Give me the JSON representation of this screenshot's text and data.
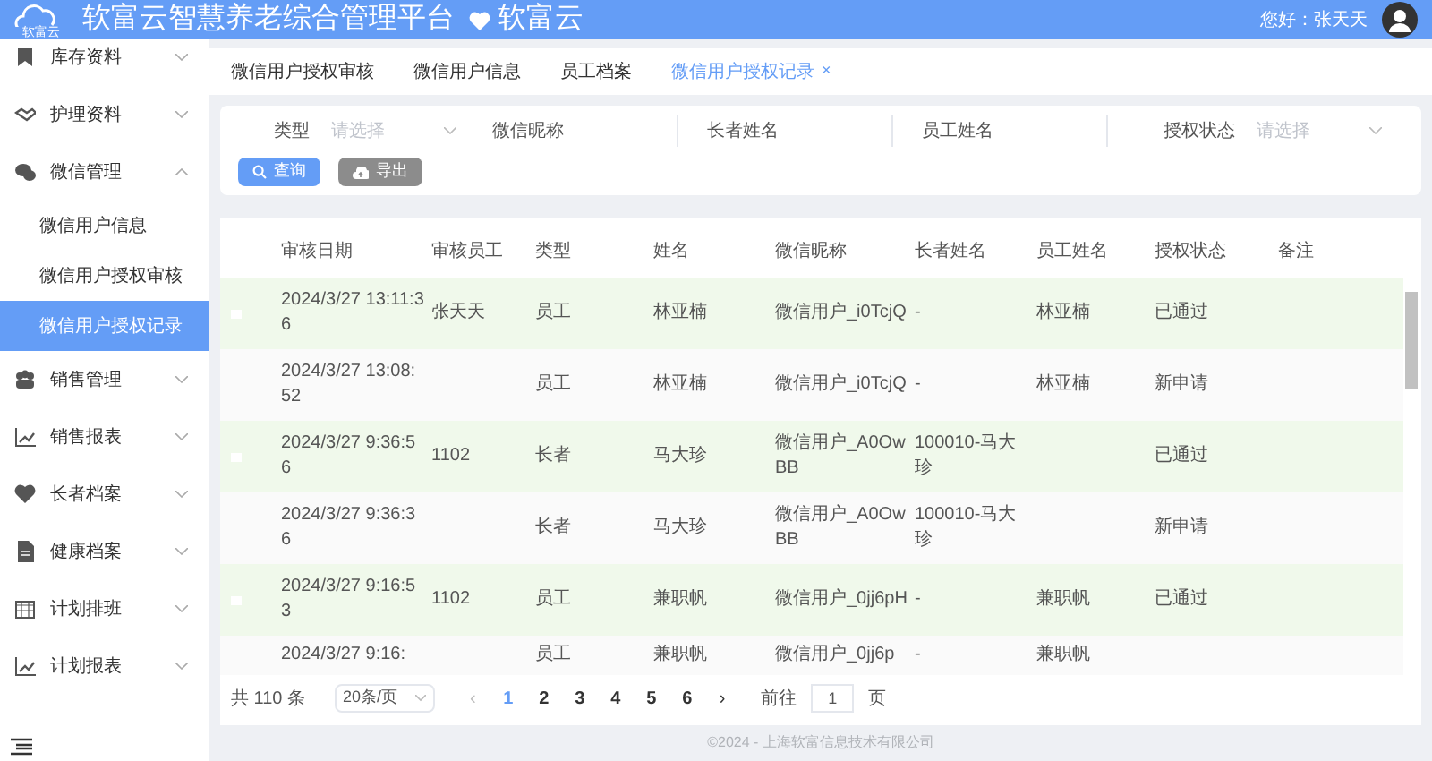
{
  "header": {
    "title": "软富云智慧养老综合管理平台",
    "brand": "软富云",
    "logo_text": "软富云",
    "greeting": "您好：张天天"
  },
  "sidebar": {
    "items": [
      {
        "label": "库存资料",
        "expanded": false
      },
      {
        "label": "护理资料",
        "expanded": false
      },
      {
        "label": "微信管理",
        "expanded": true,
        "children": [
          {
            "label": "微信用户信息",
            "selected": false
          },
          {
            "label": "微信用户授权审核",
            "selected": false
          },
          {
            "label": "微信用户授权记录",
            "selected": true
          }
        ]
      },
      {
        "label": "销售管理",
        "expanded": false
      },
      {
        "label": "销售报表",
        "expanded": false
      },
      {
        "label": "长者档案",
        "expanded": false
      },
      {
        "label": "健康档案",
        "expanded": false
      },
      {
        "label": "计划排班",
        "expanded": false
      },
      {
        "label": "计划报表",
        "expanded": false
      }
    ]
  },
  "tabs": [
    {
      "label": "微信用户授权审核",
      "selected": false
    },
    {
      "label": "微信用户信息",
      "selected": false
    },
    {
      "label": "员工档案",
      "selected": false
    },
    {
      "label": "微信用户授权记录",
      "selected": true,
      "close": "×"
    }
  ],
  "filters": [
    {
      "kind": "select",
      "label": "类型",
      "placeholder": "请选择"
    },
    {
      "kind": "input",
      "label": "微信昵称"
    },
    {
      "kind": "input",
      "label": "长者姓名"
    },
    {
      "kind": "input",
      "label": "员工姓名"
    },
    {
      "kind": "select",
      "label": "授权状态",
      "placeholder": "请选择"
    }
  ],
  "buttons": [
    {
      "kind": "search",
      "label": "查询"
    },
    {
      "kind": "export",
      "label": "导出"
    }
  ],
  "table": {
    "columns": [
      "审核日期",
      "审核员工",
      "类型",
      "姓名",
      "微信昵称",
      "长者姓名",
      "员工姓名",
      "授权状态",
      "备注"
    ],
    "rows": [
      [
        "2024/3/27 13:11:36",
        "张天天",
        "员工",
        "林亚楠",
        "微信用户_i0TcjQ",
        "-",
        "林亚楠",
        "已通过",
        ""
      ],
      [
        "2024/3/27 13:08:52",
        "",
        "员工",
        "林亚楠",
        "微信用户_i0TcjQ",
        "-",
        "林亚楠",
        "新申请",
        ""
      ],
      [
        "2024/3/27 9:36:56",
        "1102",
        "长者",
        "马大珍",
        "微信用户_A0OwBB",
        "100010-马大珍",
        "",
        "已通过",
        ""
      ],
      [
        "2024/3/27 9:36:36",
        "",
        "长者",
        "马大珍",
        "微信用户_A0OwBB",
        "100010-马大珍",
        "",
        "新申请",
        ""
      ],
      [
        "2024/3/27 9:16:53",
        "1102",
        "员工",
        "兼职帆",
        "微信用户_0jj6pH",
        "-",
        "兼职帆",
        "已通过",
        ""
      ],
      [
        "2024/3/27 9:16:",
        "",
        "员工",
        "兼职帆",
        "微信用户_0jj6p",
        "-",
        "兼职帆",
        "",
        ""
      ]
    ]
  },
  "pagination": {
    "total": "共 110 条",
    "page_size": "20条/页",
    "prev": "‹",
    "next": "›",
    "pages": [
      {
        "label": "1",
        "selected": true
      },
      {
        "label": "2",
        "selected": false
      },
      {
        "label": "3",
        "selected": false
      },
      {
        "label": "4",
        "selected": false
      },
      {
        "label": "5",
        "selected": false
      },
      {
        "label": "6",
        "selected": false
      }
    ],
    "goto_label": "前往",
    "goto_value": "1",
    "goto_unit": "页"
  },
  "footer": "©2024 - 上海软富信息技术有限公司"
}
